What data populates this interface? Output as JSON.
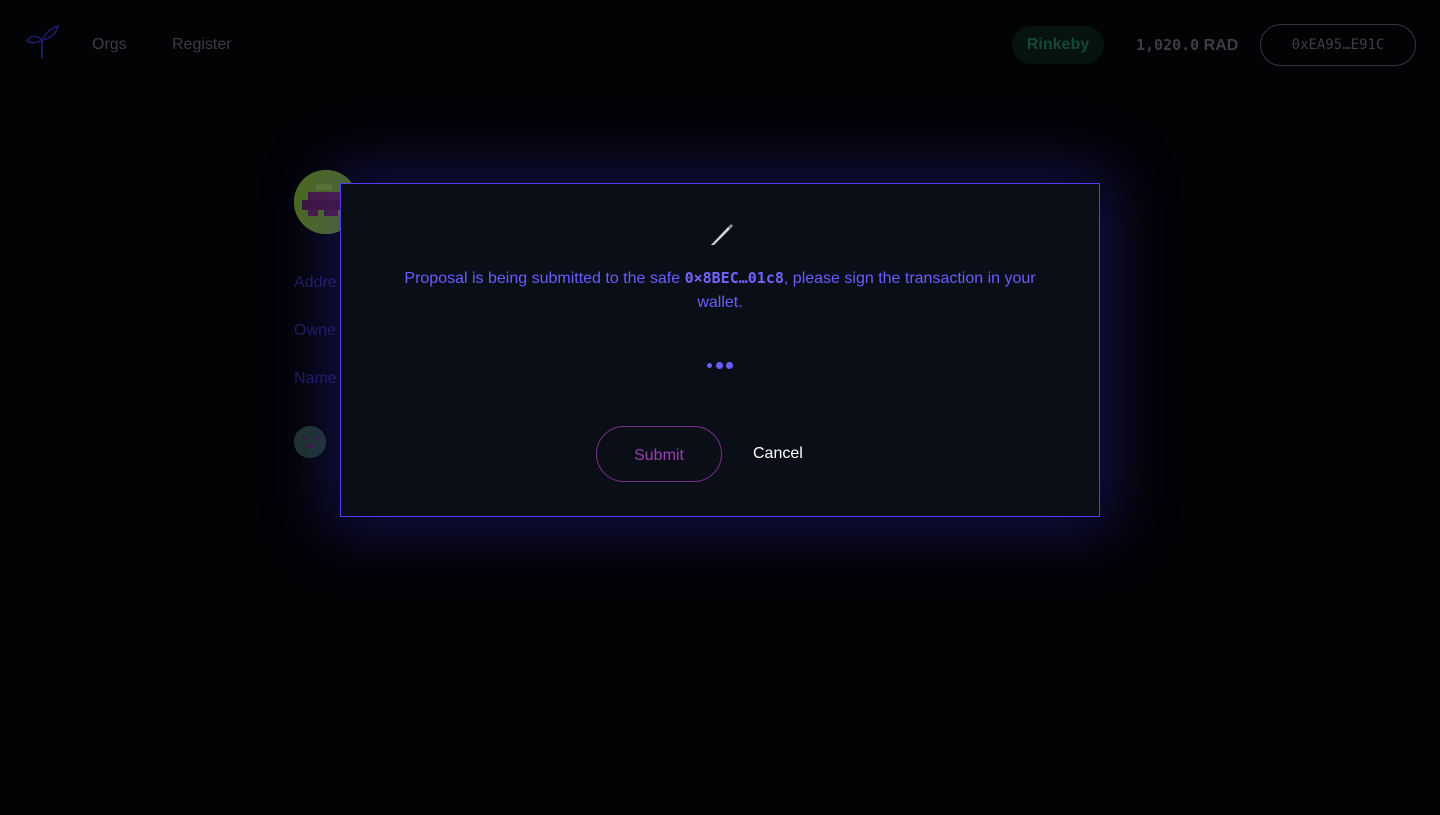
{
  "header": {
    "logo_icon": "radicle-seedling-icon",
    "nav": [
      {
        "label": "Orgs"
      },
      {
        "label": "Register"
      }
    ],
    "network": "Rinkeby",
    "balance": {
      "amount": "1,020.0",
      "unit": "RAD"
    },
    "wallet_address": "0xEA95…E91C"
  },
  "background": {
    "labels": [
      "Addre",
      "Owne",
      "Name"
    ]
  },
  "modal": {
    "icon": "pen-icon",
    "message_prefix": "Proposal is being submitted to the safe ",
    "safe_address": "0×8BEC…01c8",
    "message_suffix": ", please sign the transaction in your wallet.",
    "loader_icon": "loading-dots-icon",
    "submit_label": "Submit",
    "cancel_label": "Cancel"
  },
  "colors": {
    "accent": "#6a5cff",
    "modal_border": "#4f3ef0",
    "submit": "#9c3fb0",
    "network": "#14473a"
  }
}
